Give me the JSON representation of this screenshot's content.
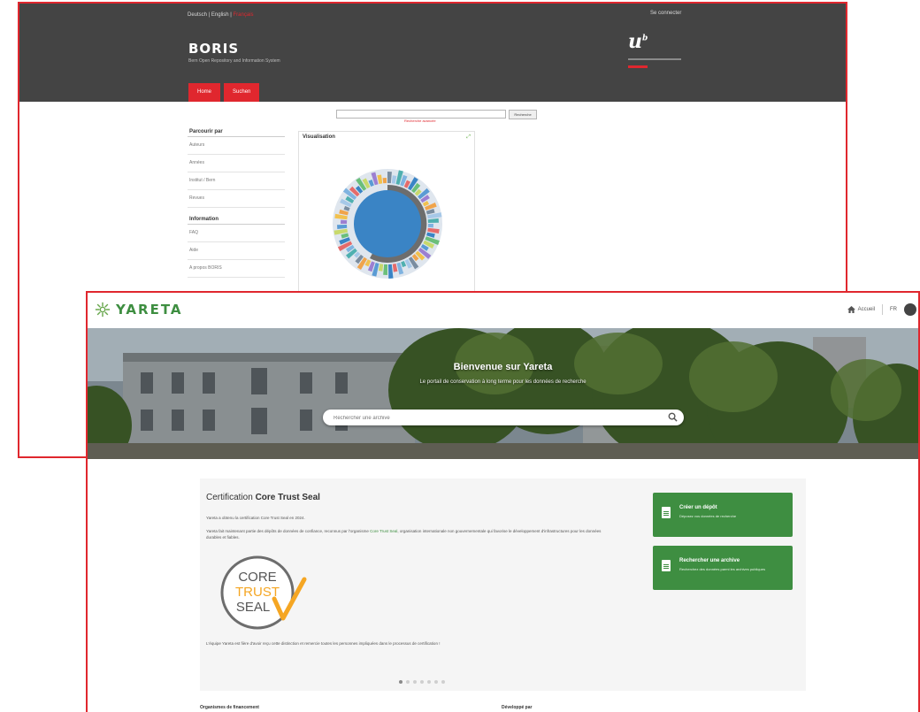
{
  "boris": {
    "top_links": [
      "Deutsch",
      "English",
      "Français"
    ],
    "login": "Se connecter",
    "title": "BORIS",
    "subtitle": "Bern Open Repository and Information System",
    "nav": [
      "Home",
      "Suchen"
    ],
    "search_button": "Recherche",
    "advanced_search": "Recherche avancée",
    "sidebar": {
      "browse_title": "Parcourir par",
      "browse_items": [
        "Auteurs",
        "Années",
        "Institut / Bern",
        "Revues"
      ],
      "info_title": "Information",
      "info_items": [
        "FAQ",
        "Aide",
        "A propos BORIS"
      ]
    },
    "viz_title": "Visualisation"
  },
  "yareta": {
    "app_name": "YARETA",
    "home_label": "Accueil",
    "lang": "FR",
    "hero_title": "Bienvenue sur Yareta",
    "hero_subtitle": "Le portail de conservation à long terme pour les données de recherche",
    "search_placeholder": "Rechercher une archive",
    "cert": {
      "title_prefix": "Certification ",
      "title_bold": "Core Trust Seal",
      "p1": "Yareta a obtenu la certification Core Trust Seal en 2024.",
      "p2_a": "Yareta fait maintenant partie des dépôts de données de confiance, reconnus par l'organisme ",
      "p2_link": "Core Trust Seal",
      "p2_b": ", organisation internationale non gouvernementale qui favorise le développement d'infrastructures pour les données durables et fiables.",
      "seal_line1": "CORE",
      "seal_line2": "TRUST",
      "seal_line3": "SEAL",
      "p3": "L'équipe Yareta est fière d'avoir reçu cette distinction et remercie toutes les personnes impliquées dans le processus de certification !"
    },
    "cards": [
      {
        "title": "Créer un dépôt",
        "subtitle": "Déposez vos données de recherche"
      },
      {
        "title": "Rechercher une archive",
        "subtitle": "Recherchez des données parmi les archives publiques"
      }
    ],
    "footer": {
      "left": "Organismes de financement",
      "right": "Développé par"
    },
    "carousel": {
      "count": 7,
      "active": 0
    }
  },
  "colors": {
    "boris_red": "#e0272e",
    "boris_header": "#444444",
    "yareta_green": "#3e8e41",
    "seal_orange": "#f5a623"
  }
}
